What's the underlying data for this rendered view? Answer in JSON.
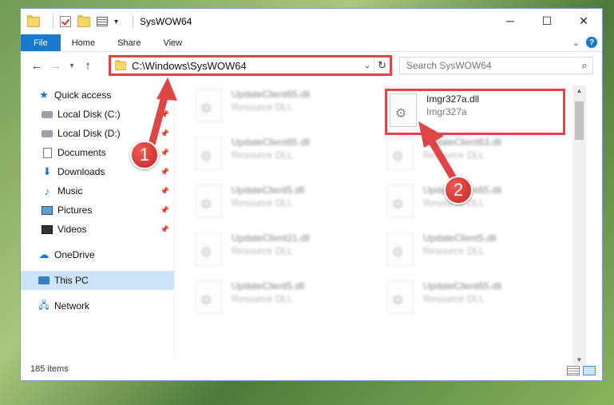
{
  "window": {
    "title": "SysWOW64",
    "controls": {
      "minimize": "─",
      "maximize": "☐",
      "close": "✕"
    }
  },
  "ribbon": {
    "tabs": [
      "File",
      "Home",
      "Share",
      "View"
    ],
    "expand_icon": "chevron-down-icon",
    "help_label": "?"
  },
  "nav": {
    "back": "←",
    "forward": "→",
    "recent": "▾",
    "up": "↑",
    "address": "C:\\Windows\\SysWOW64",
    "address_drop": "⌄",
    "refresh": "↻",
    "search_placeholder": "Search SysWOW64",
    "search_icon": "⌕"
  },
  "sidebar": {
    "quick_access": "Quick access",
    "items": [
      {
        "label": "Local Disk (C:)",
        "icon": "drive-icon",
        "pinned": true
      },
      {
        "label": "Local Disk (D:)",
        "icon": "drive-icon",
        "pinned": true
      },
      {
        "label": "Documents",
        "icon": "documents-icon",
        "pinned": true
      },
      {
        "label": "Downloads",
        "icon": "downloads-icon",
        "pinned": true
      },
      {
        "label": "Music",
        "icon": "music-icon",
        "pinned": true
      },
      {
        "label": "Pictures",
        "icon": "pictures-icon",
        "pinned": true
      },
      {
        "label": "Videos",
        "icon": "videos-icon",
        "pinned": true
      }
    ],
    "onedrive": "OneDrive",
    "this_pc": "This PC",
    "network": "Network"
  },
  "files": {
    "left_column": [
      {
        "name": "UpdateClient65.dll",
        "desc": "Resource DLL"
      },
      {
        "name": "UpdateClient65.dll",
        "desc": "Resource DLL"
      },
      {
        "name": "UpdateClient5.dll",
        "desc": "Resource DLL"
      },
      {
        "name": "UpdateClient21.dll",
        "desc": "Resource DLL"
      },
      {
        "name": "UpdateClient5.dll",
        "desc": "Resource DLL"
      }
    ],
    "right_column": [
      {
        "name": "Imgr327a.dll",
        "desc": "Imgr327a"
      },
      {
        "name": "UpdateClient63.dll",
        "desc": "Resource DLL"
      },
      {
        "name": "UpdateClient65.dll",
        "desc": "Resource DLL"
      },
      {
        "name": "UpdateClient5.dll",
        "desc": "Resource DLL"
      },
      {
        "name": "UpdateClient65.dll",
        "desc": "Resource DLL"
      }
    ]
  },
  "status": {
    "item_count": "185 items"
  },
  "callouts": {
    "one": "1",
    "two": "2",
    "color": "#e04545"
  }
}
